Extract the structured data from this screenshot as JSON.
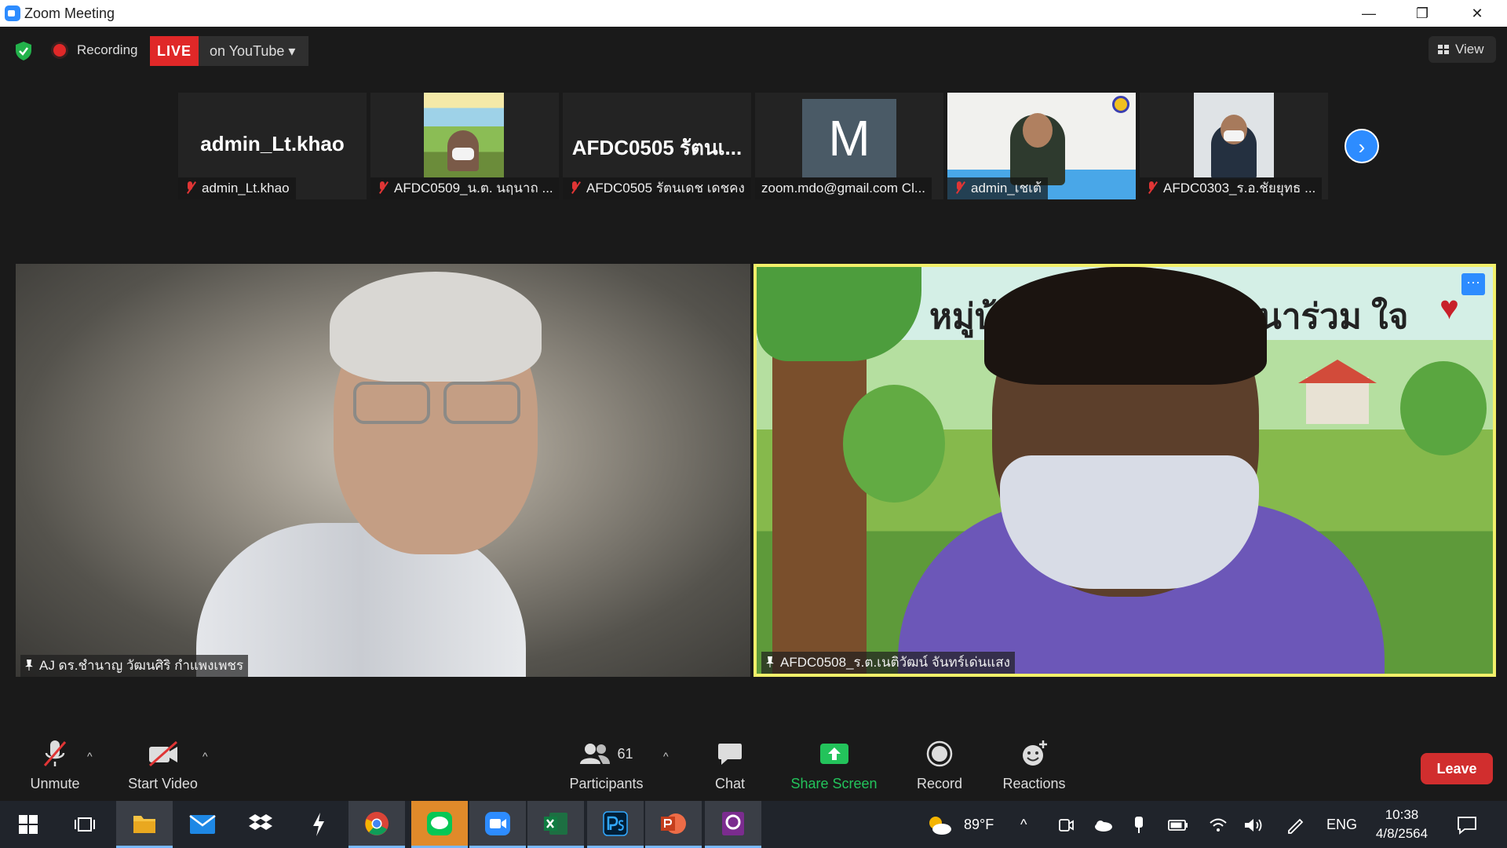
{
  "window": {
    "title": "Zoom Meeting",
    "minimize": "—",
    "maximize": "❐",
    "close": "✕"
  },
  "topbar": {
    "recording_label": "Recording",
    "live_label": "LIVE",
    "stream_label": "on YouTube ▾",
    "view_label": "View"
  },
  "thumbnails": [
    {
      "big_text": "admin_Lt.khao",
      "name": "admin_Lt.khao",
      "muted": true
    },
    {
      "big_text": "",
      "name": "AFDC0509_น.ต. นฤนาถ ...",
      "muted": true
    },
    {
      "big_text": "AFDC0505 รัตนเ...",
      "name": "AFDC0505 รัตนเดช  เดชคง",
      "muted": true
    },
    {
      "big_text": "M",
      "name": "zoom.mdo@gmail.com Cl...",
      "muted": false
    },
    {
      "big_text": "",
      "name": "admin_เชเต้",
      "muted": true
    },
    {
      "big_text": "",
      "name": "AFDC0303_ร.อ.ชัยยุทธ ...",
      "muted": true
    }
  ],
  "main_videos": [
    {
      "label": "AJ ดร.ชำนาญ วัฒนศิริ กำแพงเพชร"
    },
    {
      "label": "AFDC0508_ร.ต.เนติวัฒน์ จันทร์เด่นแสง",
      "overlay_text_left": "หมู่บ้า",
      "overlay_text_right": "พัฒนาร่วม ใจ"
    }
  ],
  "toolbar": {
    "unmute": "Unmute",
    "start_video": "Start Video",
    "participants": "Participants",
    "participants_count": "61",
    "chat": "Chat",
    "share_screen": "Share Screen",
    "record": "Record",
    "reactions": "Reactions",
    "leave": "Leave"
  },
  "taskbar": {
    "weather": "89°F",
    "language": "ENG",
    "time": "10:38",
    "date": "4/8/2564"
  },
  "colors": {
    "accent": "#2d8cff",
    "live_red": "#e02828",
    "share_green": "#23c35b",
    "leave_red": "#d12e2e",
    "active_speaker": "#f2f06a"
  }
}
